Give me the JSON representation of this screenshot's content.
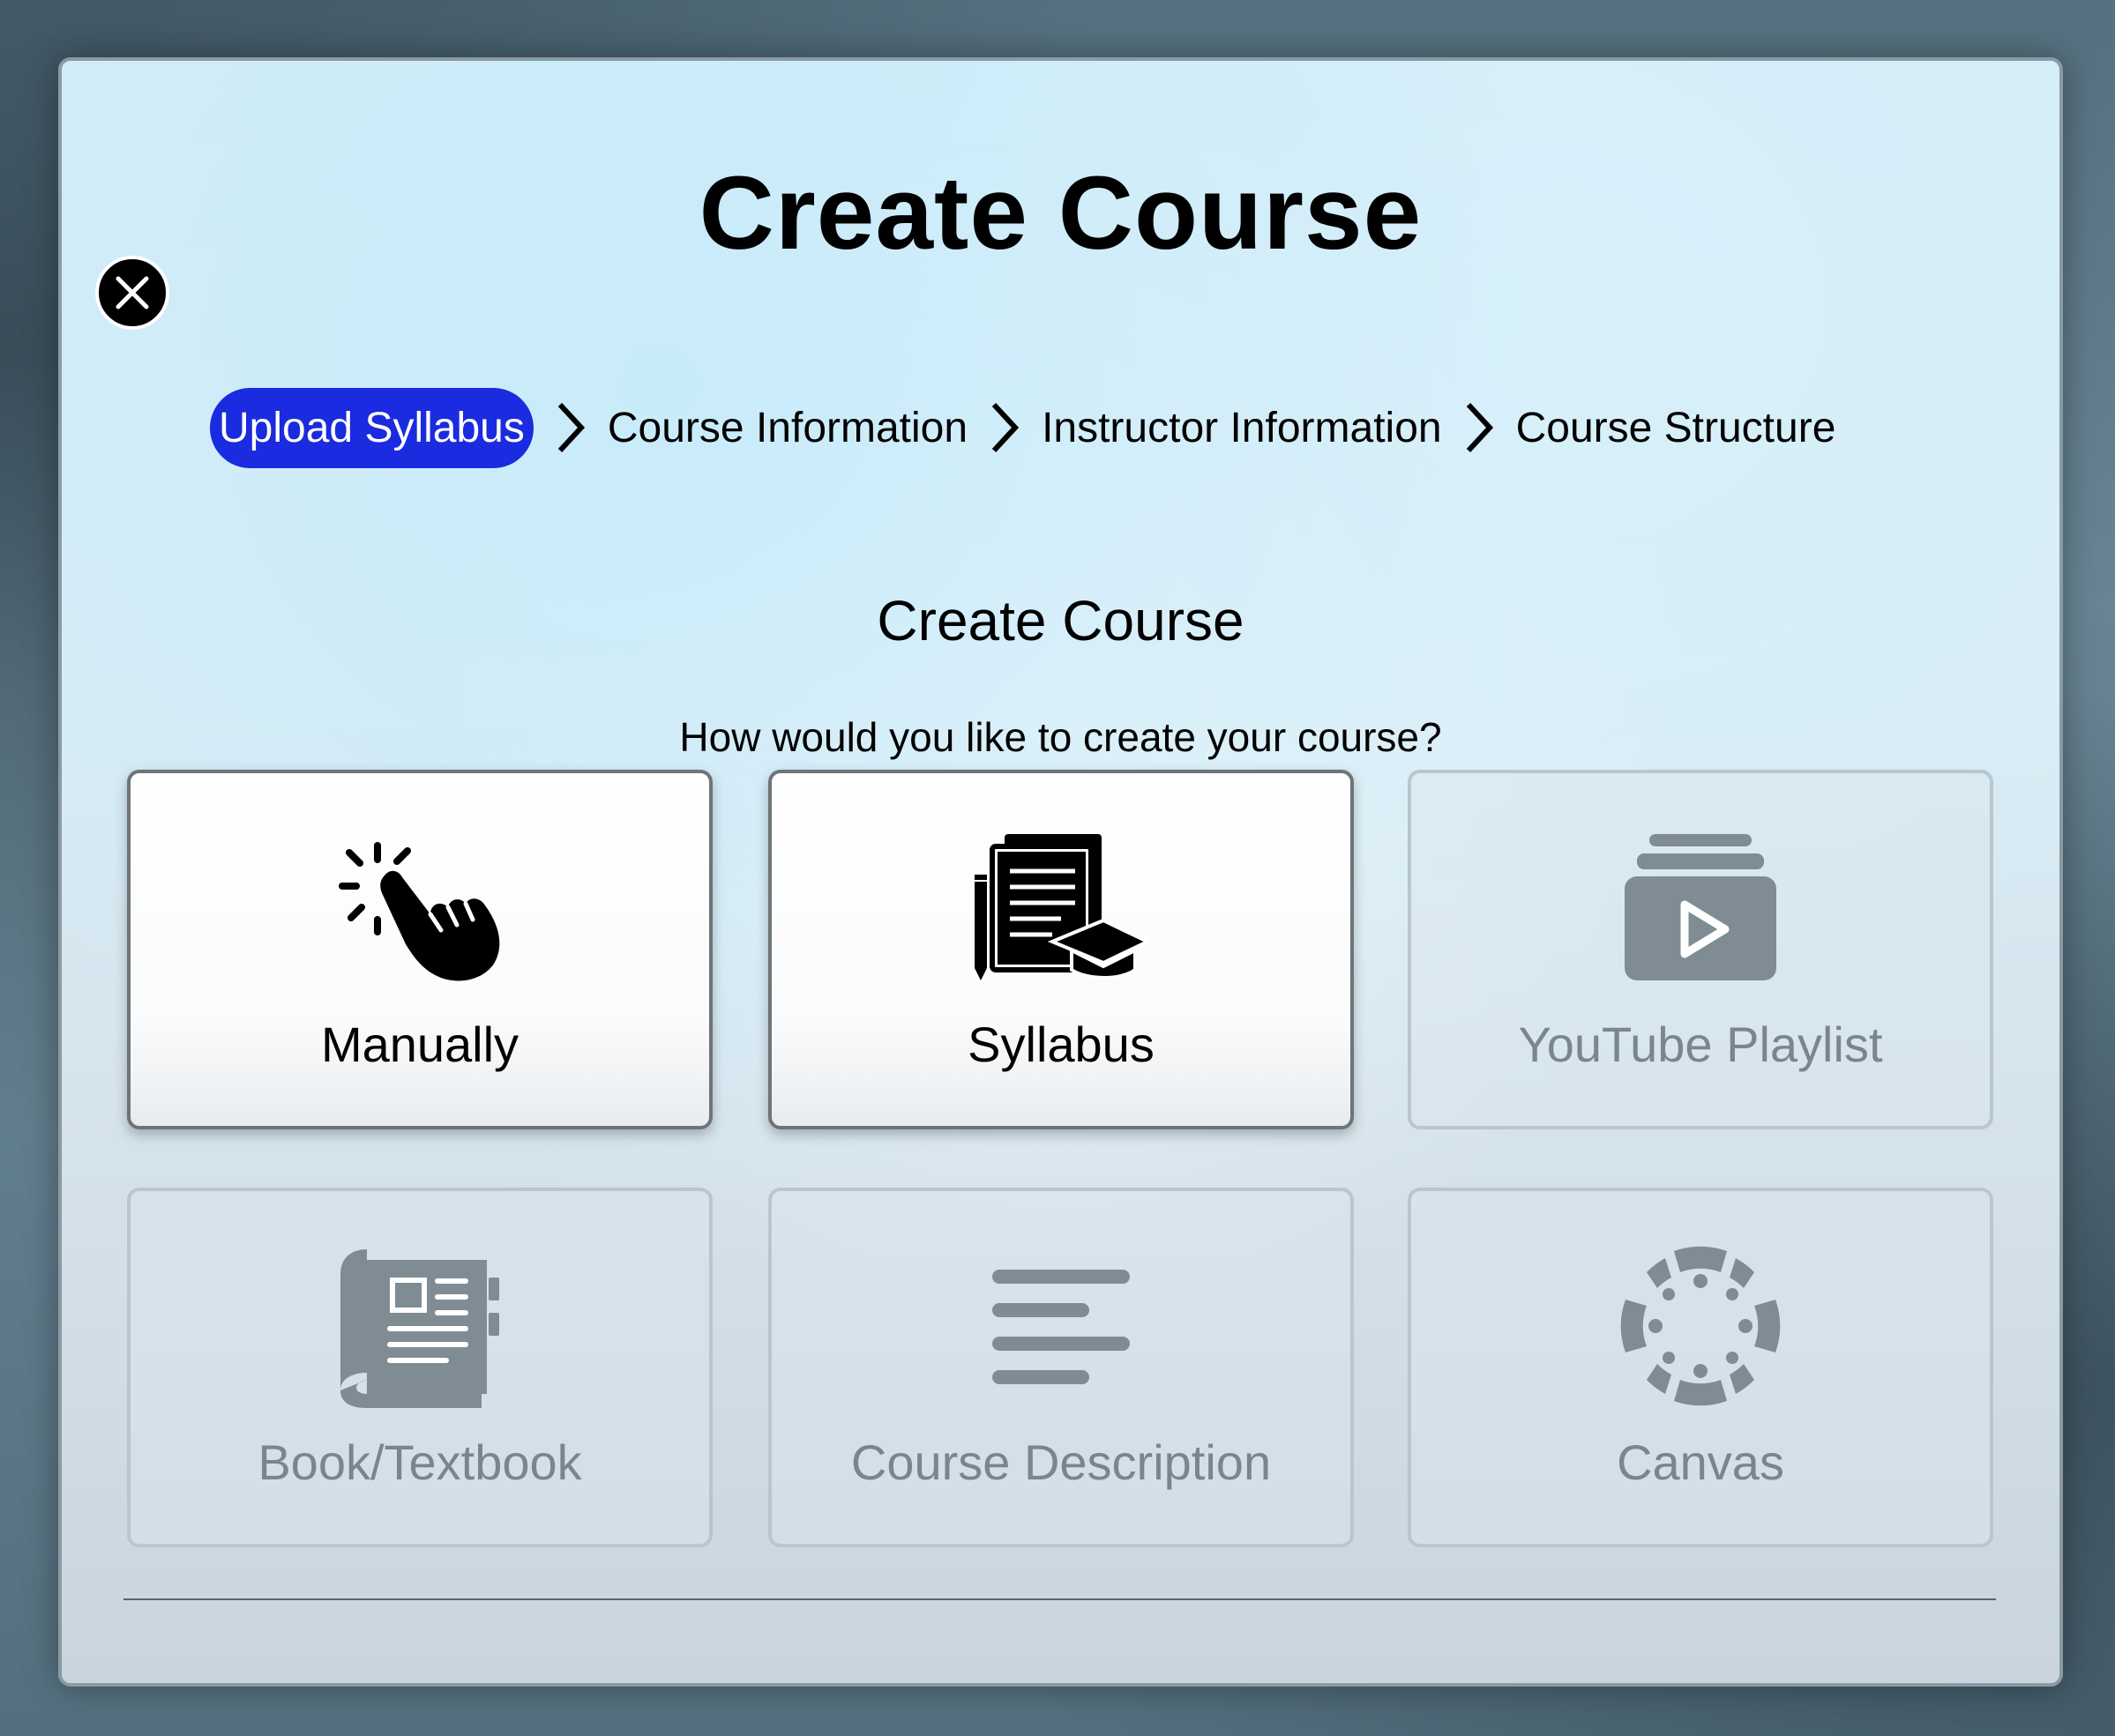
{
  "modal": {
    "title": "Create Course",
    "close_icon": "close-icon"
  },
  "stepper": {
    "steps": [
      {
        "label": "Upload Syllabus",
        "active": true
      },
      {
        "label": "Course Information",
        "active": false
      },
      {
        "label": "Instructor Information",
        "active": false
      },
      {
        "label": "Course Structure",
        "active": false
      }
    ],
    "separator_icon": "chevron-right-icon",
    "active_color": "#1a2be0"
  },
  "content": {
    "section_title": "Create Course",
    "prompt": "How would you like to create your course?"
  },
  "options": [
    {
      "label": "Manually",
      "icon": "hand-click-icon",
      "enabled": true
    },
    {
      "label": "Syllabus",
      "icon": "syllabus-icon",
      "enabled": true
    },
    {
      "label": "YouTube Playlist",
      "icon": "youtube-playlist-icon",
      "enabled": false
    },
    {
      "label": "Book/Textbook",
      "icon": "book-icon",
      "enabled": false
    },
    {
      "label": "Course Description",
      "icon": "text-lines-icon",
      "enabled": false
    },
    {
      "label": "Canvas",
      "icon": "canvas-icon",
      "enabled": false
    }
  ],
  "colors": {
    "disabled_icon": "#7f8c94",
    "enabled_icon": "#000000"
  }
}
